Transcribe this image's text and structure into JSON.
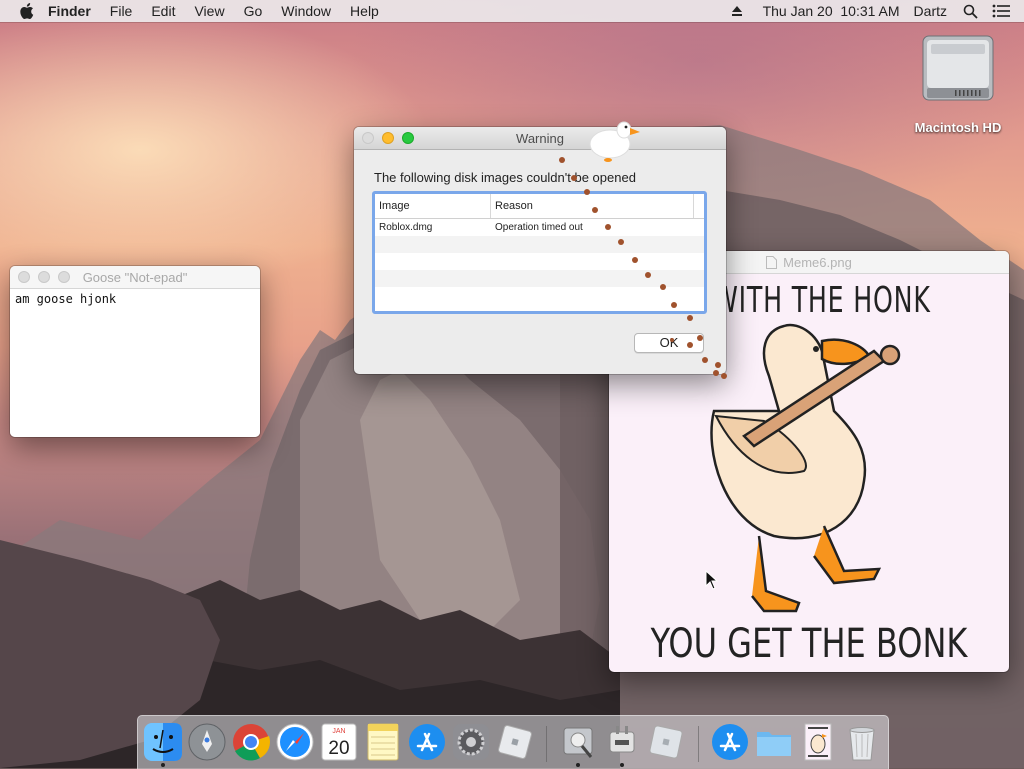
{
  "menubar": {
    "app_name": "Finder",
    "menus": [
      "File",
      "Edit",
      "View",
      "Go",
      "Window",
      "Help"
    ],
    "clock": "Thu Jan 20  10:31 AM",
    "user": "Dartz"
  },
  "desktop": {
    "hd_label": "Macintosh HD"
  },
  "notepad": {
    "title": "Goose \"Not-epad\"",
    "content": "am goose hjonk"
  },
  "image_window": {
    "title": "Meme6.png",
    "top_text": "S WITH THE HONK",
    "bottom_text": "YOU GET THE BONK"
  },
  "warning": {
    "title": "Warning",
    "message": "The following disk images couldn't be opened",
    "columns": [
      "Image",
      "Reason"
    ],
    "rows": [
      {
        "image": "Roblox.dmg",
        "reason": "Operation timed out"
      }
    ],
    "ok_label": "OK"
  },
  "dock": {
    "calendar_month": "JAN",
    "calendar_day": "20",
    "items": [
      "finder-icon",
      "launchpad-icon",
      "chrome-icon",
      "safari-icon",
      "calendar-icon",
      "notes-icon",
      "app-store-icon",
      "system-preferences-icon",
      "roblox-icon",
      "disk-utility-icon",
      "goose-app-icon",
      "roblox-studio-icon",
      "app-store-downloads-icon",
      "folder-icon",
      "meme-image-icon",
      "trash-icon"
    ]
  },
  "colors": {
    "accent": "#7aa7ea",
    "close": "#ff5f57",
    "minimize": "#ffbd2e",
    "zoom": "#28c940",
    "goose_beak": "#f7941d",
    "footprints": "#a0522d"
  }
}
